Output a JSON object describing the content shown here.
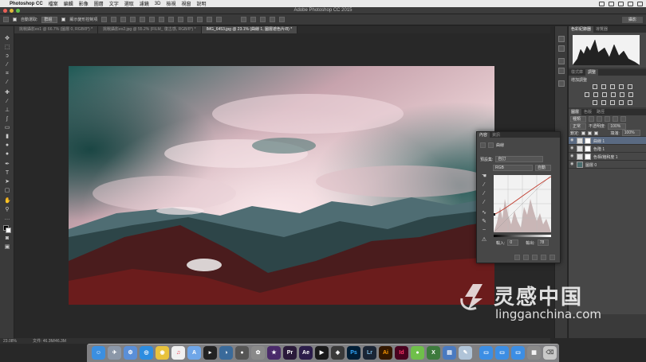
{
  "menubar": {
    "app": "Photoshop CC",
    "items": [
      "檔案",
      "編輯",
      "影像",
      "圖層",
      "文字",
      "選取",
      "濾鏡",
      "3D",
      "檢視",
      "視窗",
      "說明"
    ]
  },
  "window": {
    "title": "Adobe Photoshop CC 2015"
  },
  "options": {
    "auto_select_label": "自動選取:",
    "auto_select_value": "群組",
    "transform_label": "顯示變形控制項",
    "workspace_label": "攝影"
  },
  "tabs": [
    {
      "label": "挑戰攝影ex1 @ 66.7% (圖層 0, RGB/8*) *"
    },
    {
      "label": "挑戰攝影ex2.jpg @ 55.2% (FILM_ 復古感, RGB/8*) *"
    },
    {
      "label": "IMG_6453.jpg @ 23.1% (曲線 1, 圖層遮色片/8) *"
    }
  ],
  "status": {
    "zoom": "23.08%",
    "doc": "文件: 46.3M/46.3M"
  },
  "panels": {
    "histogram_tabs": [
      "色彩紀錄器",
      "導覽器"
    ],
    "adjust_tabs": [
      "樣式庫",
      "調整"
    ],
    "adjust_title": "增加調整",
    "layers_tabs": [
      "圖層",
      "色版",
      "路徑"
    ],
    "kind_filter": "種類",
    "blend_mode": "正常",
    "opacity_label": "不透明度:",
    "opacity_value": "100%",
    "lock_label": "鎖定:",
    "fill_label": "填滿:",
    "fill_value": "100%",
    "layers": [
      {
        "name": "曲線 1",
        "selected": true
      },
      {
        "name": "色階 1",
        "selected": false
      },
      {
        "name": "色相/飽和度 1",
        "selected": false
      },
      {
        "name": "圖層 0",
        "selected": false
      }
    ]
  },
  "properties": {
    "tabs": [
      "內容",
      "資訊"
    ],
    "type_label": "曲線",
    "preset_label": "預設集:",
    "preset_value": "自訂",
    "channel_value": "RGB",
    "auto_button": "自動",
    "input_label": "輸入:",
    "input_value": "0",
    "output_label": "輸出:",
    "output_value": "78"
  },
  "watermark": {
    "cn": "灵感中国",
    "en": "lingganchina.com"
  },
  "dock_apps": [
    "Finder",
    "Launchpad",
    "Safari",
    "Chrome",
    "iTunes",
    "Terminal",
    "Pr",
    "Ae",
    "Ps",
    "Lr",
    "Ai",
    "Id",
    "Trash"
  ]
}
